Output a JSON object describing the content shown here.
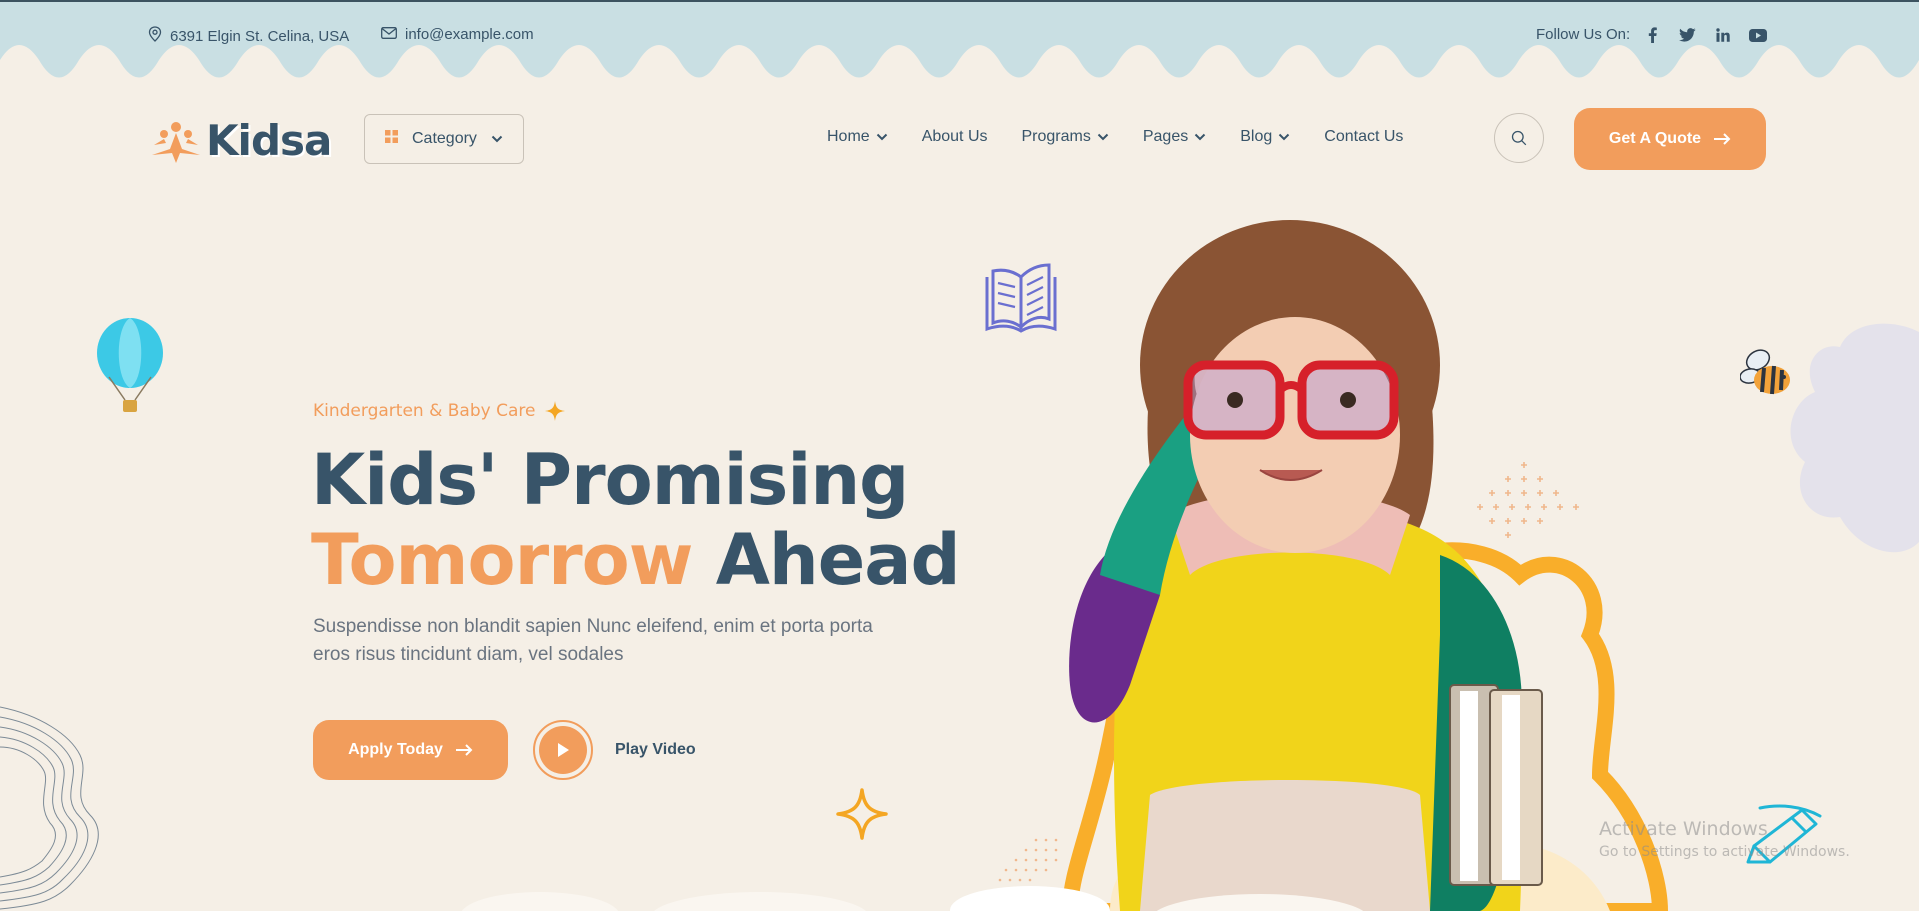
{
  "topbar": {
    "address": "6391 Elgin St. Celina, USA",
    "email": "info@example.com",
    "follow_label": "Follow Us On:",
    "social": [
      {
        "icon": "facebook-icon",
        "glyph": "f"
      },
      {
        "icon": "twitter-icon",
        "glyph": "🐦"
      },
      {
        "icon": "linkedin-icon",
        "glyph": "in"
      },
      {
        "icon": "youtube-icon",
        "glyph": "▶"
      }
    ]
  },
  "header": {
    "logo": "Kidsa",
    "category_label": "Category",
    "nav": [
      {
        "label": "Home",
        "dropdown": true
      },
      {
        "label": "About Us",
        "dropdown": false
      },
      {
        "label": "Programs",
        "dropdown": true
      },
      {
        "label": "Pages",
        "dropdown": true
      },
      {
        "label": "Blog",
        "dropdown": true
      },
      {
        "label": "Contact Us",
        "dropdown": false
      }
    ],
    "quote_label": "Get A Quote"
  },
  "hero": {
    "eyebrow": "Kindergarten & Baby Care",
    "headline_line1": "Kids' Promising",
    "headline_accent": "Tomorrow",
    "headline_rest": " Ahead",
    "description": "Suspendisse non blandit sapien Nunc eleifend, enim et porta porta eros risus tincidunt diam, vel sodales",
    "apply_label": "Apply Today",
    "play_label": "Play Video"
  },
  "watermark": {
    "title": "Activate Windows",
    "subtitle": "Go to Settings to activate Windows."
  },
  "colors": {
    "background": "#f5efe6",
    "topbar": "#c9dfe3",
    "accent": "#f29d5c",
    "heading": "#385469",
    "star": "#f4a623"
  }
}
